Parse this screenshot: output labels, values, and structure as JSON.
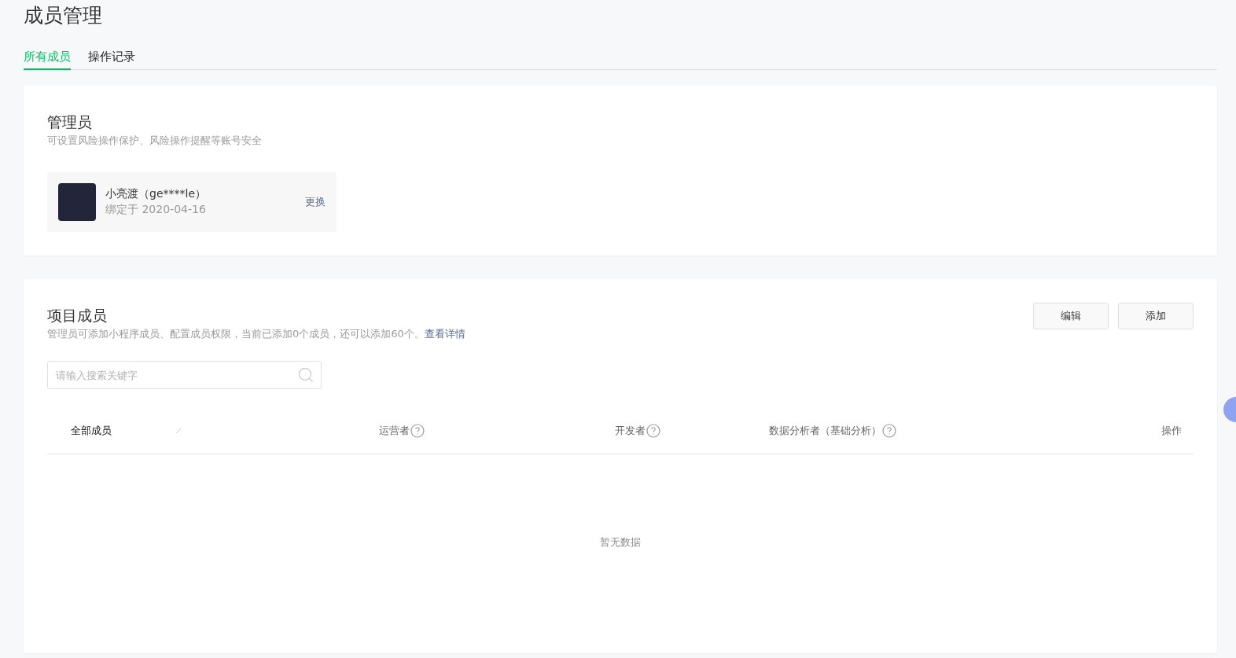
{
  "page_title": "成员管理",
  "tabs": [
    {
      "label": "所有成员",
      "selected": true
    },
    {
      "label": "操作记录",
      "selected": false
    }
  ],
  "admin_section": {
    "title": "管理员",
    "description": "可设置风险操作保护、风险操作提醒等账号安全",
    "admin": {
      "name": "小亮渡（ge****le）",
      "bound_date": "绑定于 2020-04-16",
      "action": "更换"
    }
  },
  "members_section": {
    "title": "项目成员",
    "description": "管理员可添加小程序成员、配置成员权限，当前已添加0个成员，还可以添加60个。",
    "link": "查看详情",
    "buttons": [
      "编辑",
      "添加"
    ],
    "search": {
      "placeholder": "请输入搜索关键字"
    },
    "table": {
      "columns": [
        {
          "label": "全部成员",
          "kind": "filter"
        },
        {
          "label": "运营者",
          "kind": "help"
        },
        {
          "label": "开发者",
          "kind": "help"
        },
        {
          "label": "数据分析者（基础分析）",
          "kind": "help"
        },
        {
          "label": "操作",
          "kind": "plain"
        }
      ],
      "empty_text": "暂无数据"
    }
  }
}
